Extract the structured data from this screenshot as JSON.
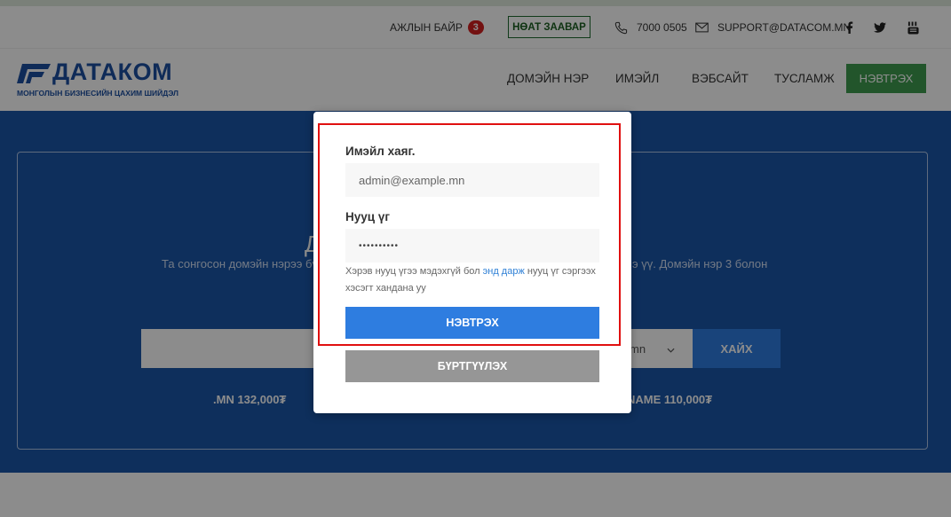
{
  "topbar": {
    "jobs_label": "АЖЛЫН БАЙР",
    "jobs_count": "3",
    "guide_label": "НӨАТ ЗААВАР",
    "phone": "7000 0505",
    "email": "SUPPORT@DATACOM.MN",
    "social": [
      "facebook-icon",
      "twitter-icon",
      "youtube-icon"
    ]
  },
  "header": {
    "logo_title": "ДАТАКОМ",
    "logo_subtitle": "МОНГОЛЫН БИЗНЕСИЙН ЦАХИМ ШИЙДЭЛ",
    "nav": [
      "ДОМЭЙН НЭР",
      "ИМЭЙЛ",
      "ВЭБСАЙТ",
      "ТУСЛАМЖ"
    ],
    "login_label": "НЭВТРЭХ"
  },
  "hero": {
    "title_fragment": "Д",
    "text_left": "Та сонгосон домэйн нэрээ бү",
    "text_right": "э үү. Домэйн нэр 3 болон",
    "ext_fragment": "mn",
    "search_label": "ХАЙХ",
    "price_left": ".MN 132,000₮",
    "price_right": "NAME 110,000₮"
  },
  "login_modal": {
    "email_label": "Имэйл хаяг.",
    "email_value": "admin@example.mn",
    "password_label": "Нууц үг",
    "password_value": "••••••••••",
    "help_prefix": "Хэрэв нууц үгээ мэдэхгүй бол",
    "help_link": "энд дарж",
    "help_suffix": "нууц үг сэргээх хэсэгт хандана уу",
    "submit_label": "НЭВТРЭХ",
    "register_label": "БҮРТГҮҮЛЭХ"
  },
  "colors": {
    "brand_blue": "#1c4fa1",
    "hero_blue": "#1a56a8",
    "primary_button": "#2e7de0",
    "login_green": "#3f9c4f",
    "highlight_red": "#e01010"
  }
}
